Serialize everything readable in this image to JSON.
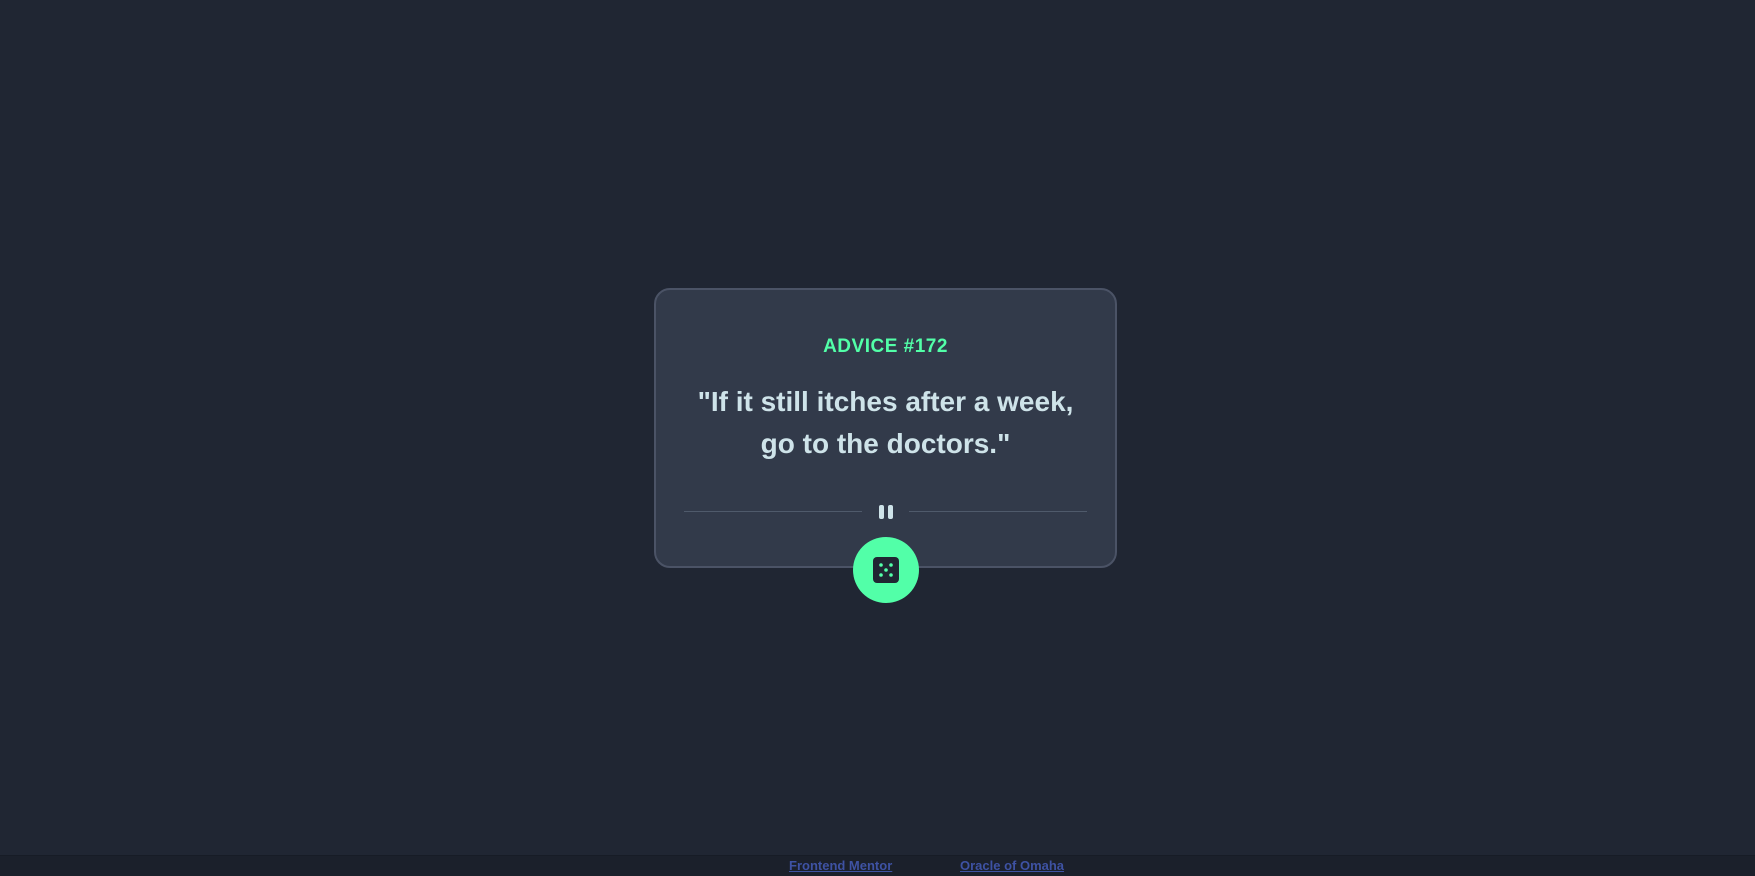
{
  "card": {
    "advice_id": "ADVICE #172",
    "quote_line_1": "\"If it still itches after a week,",
    "quote_line_2": "go to the doctors.\""
  },
  "icons": {
    "divider": "pause-divider-icon",
    "dice": "dice-icon"
  },
  "footer": {
    "left_link": "Frontend Mentor",
    "right_link": "Oracle of Omaha"
  },
  "colors": {
    "background": "#202633",
    "card": "#323a4a",
    "accent": "#52ffa8",
    "text": "#cee3e9",
    "link": "#3e52a3"
  }
}
